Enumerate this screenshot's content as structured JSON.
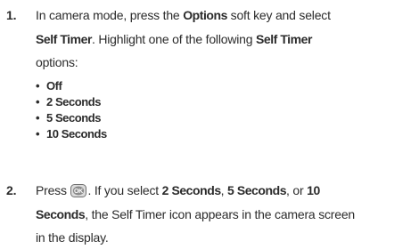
{
  "step1": {
    "number": "1.",
    "line1_pre": "In camera mode, press the ",
    "line1_bold": "Options",
    "line1_post": " soft key and select",
    "line2_bold1": "Self Timer",
    "line2_mid": ". Highlight one of the following ",
    "line2_bold2": "Self Timer",
    "line3": "options:",
    "bullet_glyph": "•",
    "options": [
      "Off",
      "2 Seconds",
      "5 Seconds",
      "10 Seconds"
    ]
  },
  "step2": {
    "number": "2.",
    "line1_pre": "Press ",
    "ok_icon": "ok-key-icon",
    "ok_icon_text": "OK",
    "line1_mid": ". If you select ",
    "line1_bold1": "2 Seconds",
    "line1_sep1": ", ",
    "line1_bold2": "5 Seconds",
    "line1_sep2": ", or ",
    "line1_bold3": "10",
    "line2_bold": "Seconds",
    "line2_post": ", the Self Timer icon appears in the camera screen",
    "line3": "in the display."
  }
}
